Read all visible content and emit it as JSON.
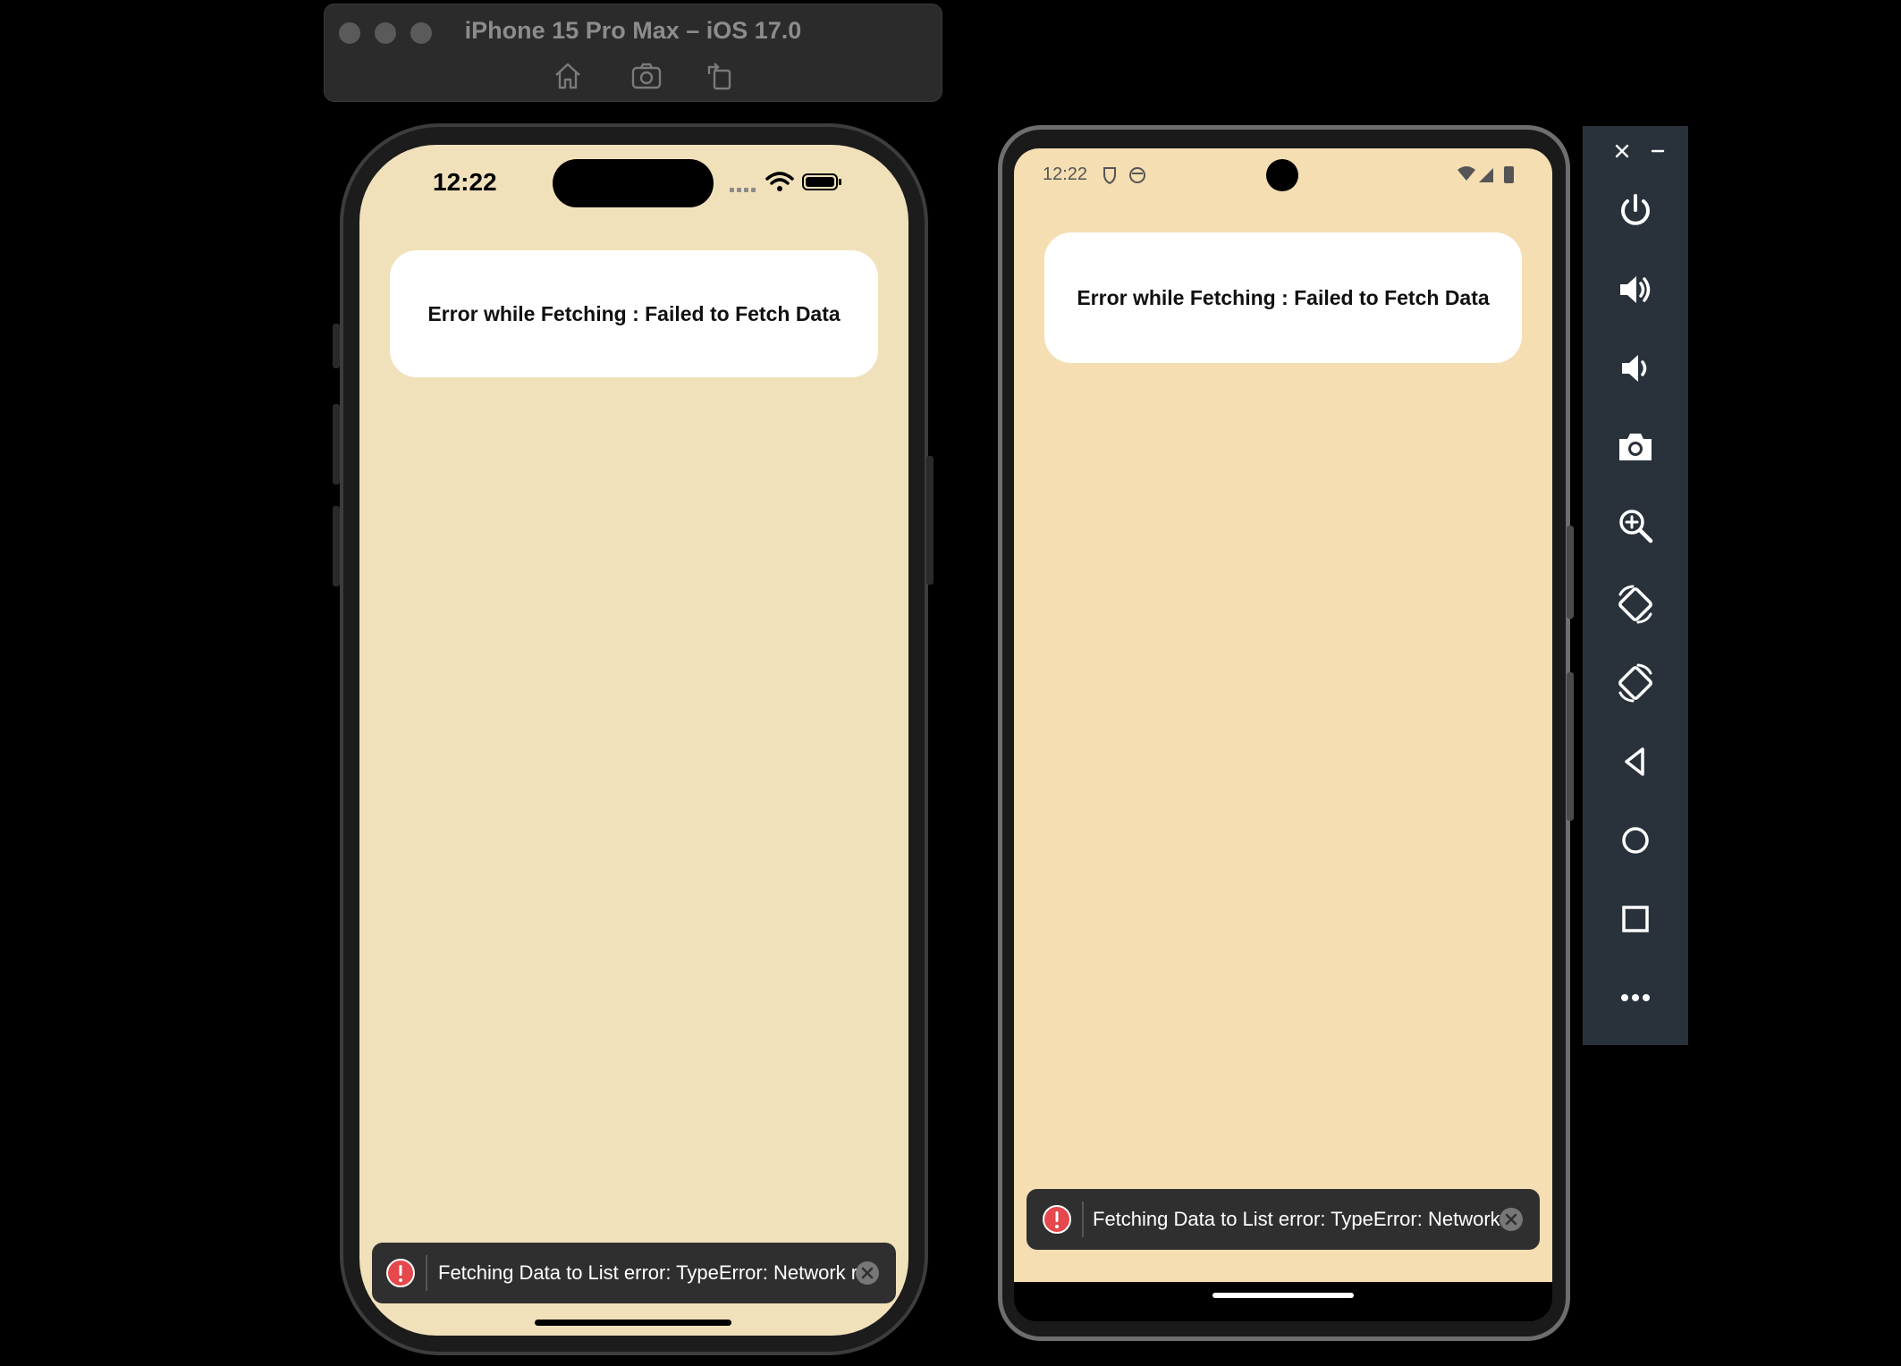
{
  "simulator": {
    "title": "iPhone 15 Pro Max – iOS 17.0",
    "tools": [
      "home-icon",
      "screenshot-icon",
      "rotate-icon"
    ]
  },
  "ios": {
    "time": "12:22",
    "card_text": "Error while Fetching : Failed to Fetch Data",
    "toast_text": "Fetching Data to List error: TypeError: Network r...",
    "background": "#f1e1bb"
  },
  "android": {
    "time": "12:22",
    "card_text": "Error while Fetching : Failed to Fetch Data",
    "toast_text": "Fetching Data to List error: TypeError: Network ...",
    "background": "#f4deb2"
  },
  "emulator_panel": {
    "buttons": [
      "power-icon",
      "volume-up-icon",
      "volume-down-icon",
      "camera-icon",
      "zoom-icon",
      "rotate-left-icon",
      "rotate-right-icon",
      "back-icon",
      "home-icon",
      "overview-icon",
      "more-icon"
    ]
  },
  "colors": {
    "toast_bg": "#2f2f2f",
    "error_red": "#e5484d",
    "panel_bg": "#29323b"
  }
}
